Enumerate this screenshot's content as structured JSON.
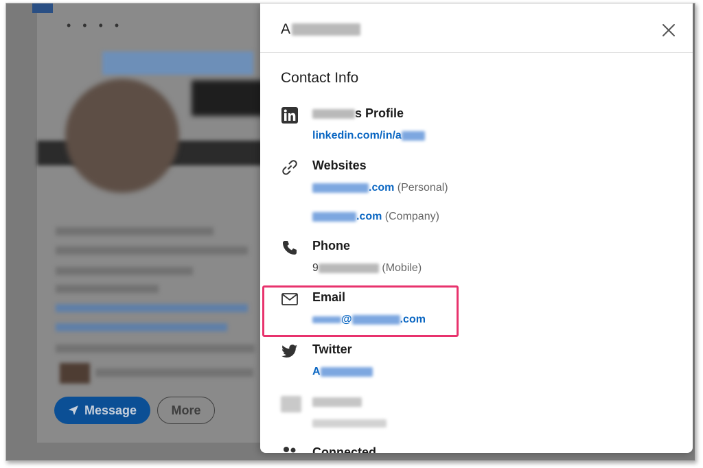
{
  "background": {
    "message_label": "Message",
    "more_label": "More"
  },
  "modal": {
    "title_visible": "A",
    "section_title": "Contact Info",
    "profile": {
      "label_suffix": "s Profile",
      "link_prefix": "linkedin.com/in/a"
    },
    "websites": {
      "label": "Websites",
      "personal": {
        "link_suffix": ".com",
        "type": "(Personal)"
      },
      "company": {
        "link_suffix": ".com",
        "type": "(Company)"
      }
    },
    "phone": {
      "label": "Phone",
      "value_prefix": "9",
      "type": "(Mobile)"
    },
    "email": {
      "label": "Email",
      "at": "@",
      "suffix": ".com"
    },
    "twitter": {
      "label": "Twitter",
      "handle_prefix": "A"
    },
    "connected": {
      "label": "Connected"
    }
  },
  "colors": {
    "link": "#0a66c2",
    "highlight": "#e8336d",
    "overlay": "#7a7a7a"
  }
}
